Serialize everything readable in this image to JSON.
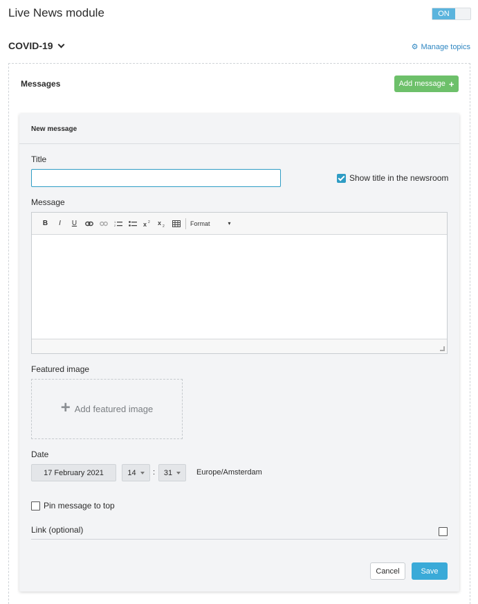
{
  "header": {
    "title": "Live News module",
    "toggle_on_label": "ON"
  },
  "topic": {
    "name": "COVID-19",
    "manage_topics_label": "Manage topics"
  },
  "messages": {
    "section_label": "Messages",
    "add_message_label": "Add message"
  },
  "form": {
    "card_header": "New message",
    "title_label": "Title",
    "title_value": "",
    "show_title_label": "Show title in the newsroom",
    "show_title_checked": true,
    "message_label": "Message",
    "toolbar": {
      "bold": "B",
      "italic": "I",
      "underline": "U",
      "format_label": "Format"
    },
    "featured_image_label": "Featured image",
    "add_featured_image_label": "Add featured image",
    "date_label": "Date",
    "date_value": "17 February 2021",
    "hour_value": "14",
    "minute_value": "31",
    "time_separator": ":",
    "timezone": "Europe/Amsterdam",
    "pin_label": "Pin message to top",
    "pin_checked": false,
    "link_label": "Link (optional)",
    "link_checked": false,
    "cancel_label": "Cancel",
    "save_label": "Save"
  },
  "colors": {
    "accent_blue": "#3aaad8",
    "add_green": "#6dc06a",
    "toggle_on": "#5bb4dd",
    "link_blue": "#2e86c1"
  }
}
